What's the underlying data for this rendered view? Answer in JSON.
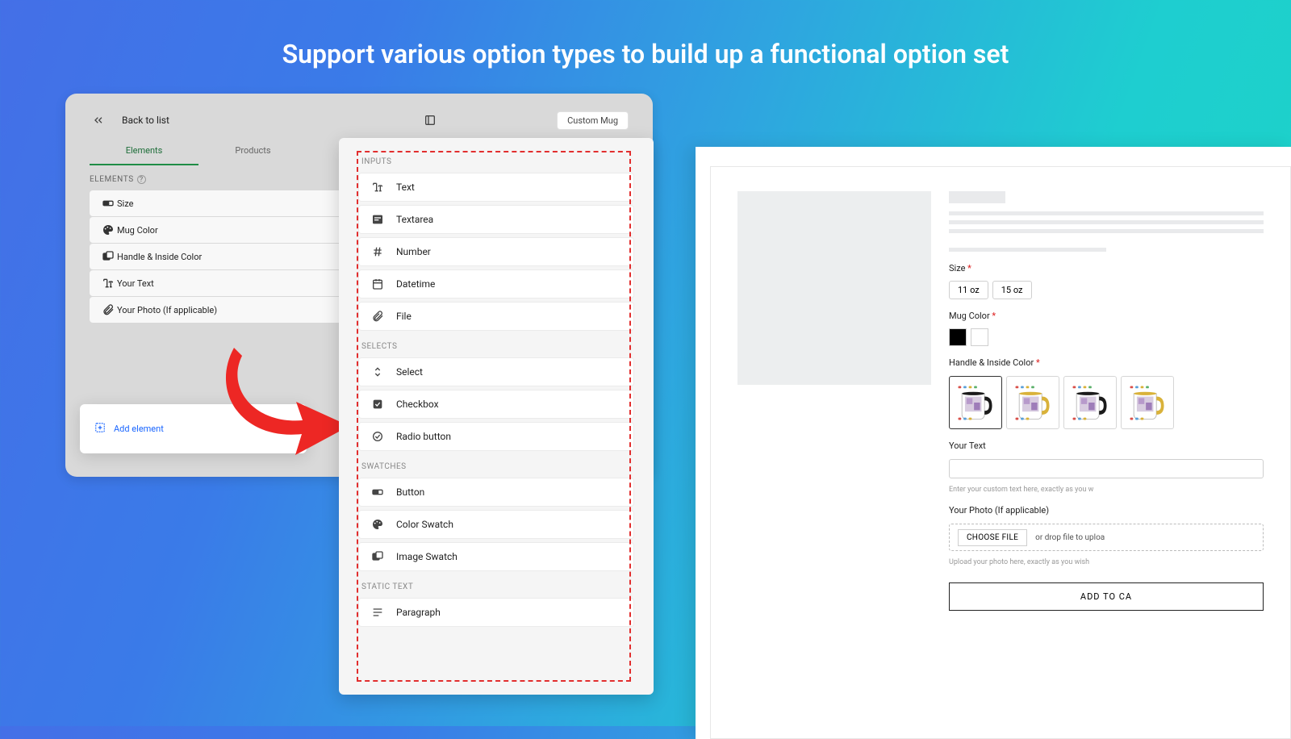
{
  "headline": "Support various option types to build up a functional option set",
  "left": {
    "back": "Back to list",
    "chip": "Custom Mug",
    "tabs": [
      "Elements",
      "Products"
    ],
    "section": "ELEMENTS",
    "items": [
      {
        "icon": "button-swatch-icon",
        "label": "Size"
      },
      {
        "icon": "palette-icon",
        "label": "Mug Color"
      },
      {
        "icon": "image-swatch-icon",
        "label": "Handle & Inside Color"
      },
      {
        "icon": "text-icon",
        "label": "Your Text"
      },
      {
        "icon": "attachment-icon",
        "label": "Your Photo (If applicable)"
      }
    ],
    "add": "Add element"
  },
  "types": {
    "groups": [
      {
        "title": "INPUTS",
        "items": [
          {
            "icon": "text-icon",
            "label": "Text"
          },
          {
            "icon": "textarea-icon",
            "label": "Textarea"
          },
          {
            "icon": "number-icon",
            "label": "Number"
          },
          {
            "icon": "datetime-icon",
            "label": "Datetime"
          },
          {
            "icon": "attachment-icon",
            "label": "File"
          }
        ]
      },
      {
        "title": "SELECTS",
        "items": [
          {
            "icon": "select-icon",
            "label": "Select"
          },
          {
            "icon": "checkbox-icon",
            "label": "Checkbox"
          },
          {
            "icon": "radio-icon",
            "label": "Radio button"
          }
        ]
      },
      {
        "title": "SWATCHES",
        "items": [
          {
            "icon": "button-swatch-icon",
            "label": "Button"
          },
          {
            "icon": "palette-icon",
            "label": "Color Swatch"
          },
          {
            "icon": "image-swatch-icon",
            "label": "Image Swatch"
          }
        ]
      },
      {
        "title": "STATIC TEXT",
        "items": [
          {
            "icon": "paragraph-icon",
            "label": "Paragraph"
          }
        ]
      }
    ]
  },
  "preview": {
    "size_label": "Size",
    "sizes": [
      "11 oz",
      "15 oz"
    ],
    "mugcolor_label": "Mug Color",
    "handcolor_label": "Handle & Inside Color",
    "yourtext_label": "Your Text",
    "yourtext_hint": "Enter your custom text here, exactly as you w",
    "photo_label": "Your Photo (If applicable)",
    "choose": "CHOOSE FILE",
    "drop": "or drop file to uploa",
    "photo_hint": "Upload your photo here, exactly as you wish",
    "cart": "ADD TO CA",
    "mug_variants": [
      "#1b1b1b",
      "#d9b23a",
      "#1b1b1b",
      "#d9b23a"
    ]
  }
}
